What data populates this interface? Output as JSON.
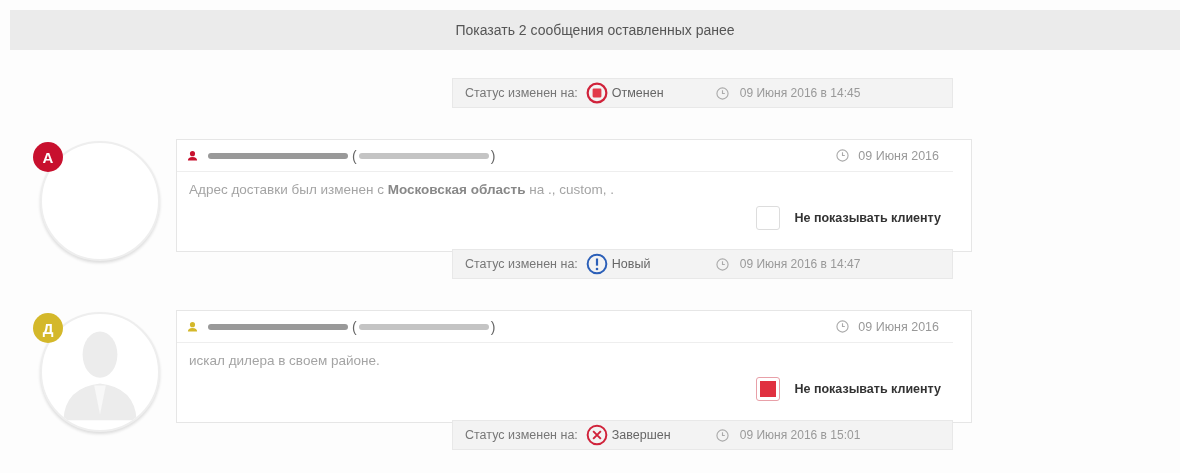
{
  "show_earlier": "Показать 2 сообщения оставленных ранее",
  "entries": [
    {
      "kind": "status",
      "label": "Статус изменен на:",
      "icon": {
        "kind": "cancelled"
      },
      "status": "Отменен",
      "time": "09 Июня 2016 в 14:45"
    },
    {
      "kind": "comment",
      "badge": "А",
      "color": "#c8102e",
      "avatar": {
        "kind": "blank"
      },
      "paren_open": "(",
      "paren_close": ")",
      "date": "09 Июня 2016",
      "text": "Адрес доставки был изменен с **Московская область** на ., custom, .",
      "hide_label": "Не показывать клиенту",
      "checked": false,
      "status": {
        "label": "Статус изменен на:",
        "icon": {
          "kind": "new"
        },
        "status": "Новый",
        "time": "09 Июня 2016 в 14:47"
      }
    },
    {
      "kind": "comment",
      "badge": "Д",
      "color": "#d4b82a",
      "avatar": {
        "kind": "silhouette"
      },
      "paren_open": "(",
      "paren_close": ")",
      "date": "09 Июня 2016",
      "text": "искал дилера в своем районе.",
      "hide_label": "Не показывать клиенту",
      "checked": true,
      "status": {
        "label": "Статус изменен на:",
        "icon": {
          "kind": "done"
        },
        "status": "Завершен",
        "time": "09 Июня 2016 в 15:01"
      }
    }
  ]
}
